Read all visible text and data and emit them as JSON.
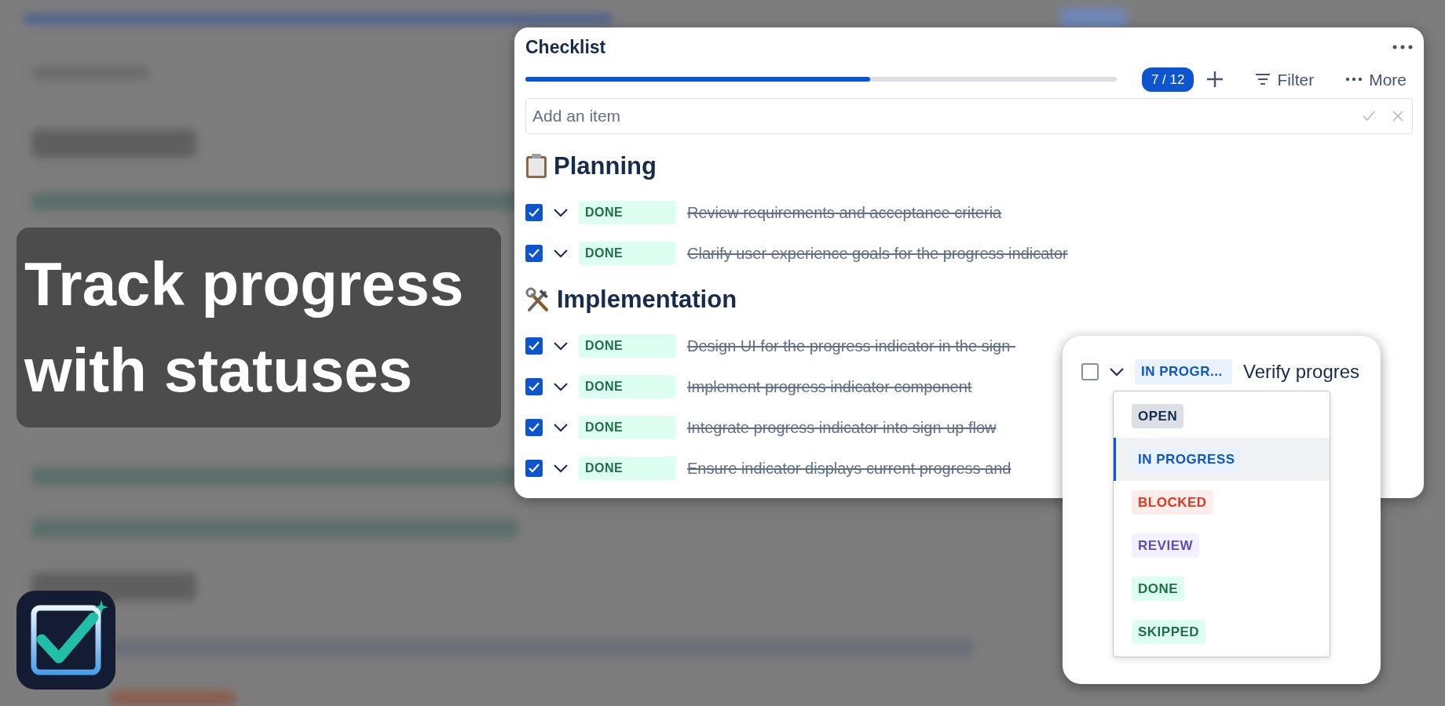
{
  "headline": "Track progress with statuses",
  "checklist": {
    "title": "Checklist",
    "level": 0.583,
    "count": "7 / 12",
    "filter_label": "Filter",
    "more_label": "More",
    "add_field": {
      "placeholder": "Add an item"
    },
    "sections": [
      {
        "title": "Planning",
        "kind": "clipboard",
        "items": [
          {
            "checked": true,
            "status": {
              "label": "DONE",
              "kind": "done"
            },
            "text": "Review requirements and acceptance criteria"
          },
          {
            "checked": true,
            "status": {
              "label": "DONE",
              "kind": "done"
            },
            "text": "Clarify user experience goals for the progress indicator"
          }
        ]
      },
      {
        "title": "Implementation",
        "kind": "tools",
        "items": [
          {
            "checked": true,
            "status": {
              "label": "DONE",
              "kind": "done"
            },
            "text": "Design UI for the progress indicator in the sign-"
          },
          {
            "checked": true,
            "status": {
              "label": "DONE",
              "kind": "done"
            },
            "text": "Implement progress indicator component"
          },
          {
            "checked": true,
            "status": {
              "label": "DONE",
              "kind": "done"
            },
            "text": "Integrate progress indicator into sign-up flow"
          },
          {
            "checked": true,
            "status": {
              "label": "DONE",
              "kind": "done"
            },
            "text": "Ensure indicator displays current progress and"
          }
        ]
      }
    ]
  },
  "popover": {
    "item": {
      "checked": false,
      "status": {
        "label": "IN PROGR...",
        "kind": "in_progress"
      },
      "text": "Verify progres"
    },
    "options": [
      {
        "label": "OPEN",
        "kind": "open",
        "selected": false
      },
      {
        "label": "IN PROGRESS",
        "kind": "in_progress",
        "selected": true
      },
      {
        "label": "BLOCKED",
        "kind": "blocked",
        "selected": false
      },
      {
        "label": "REVIEW",
        "kind": "review",
        "selected": false
      },
      {
        "label": "DONE",
        "kind": "done",
        "selected": false
      },
      {
        "label": "SKIPPED",
        "kind": "skipped",
        "selected": false
      }
    ]
  }
}
